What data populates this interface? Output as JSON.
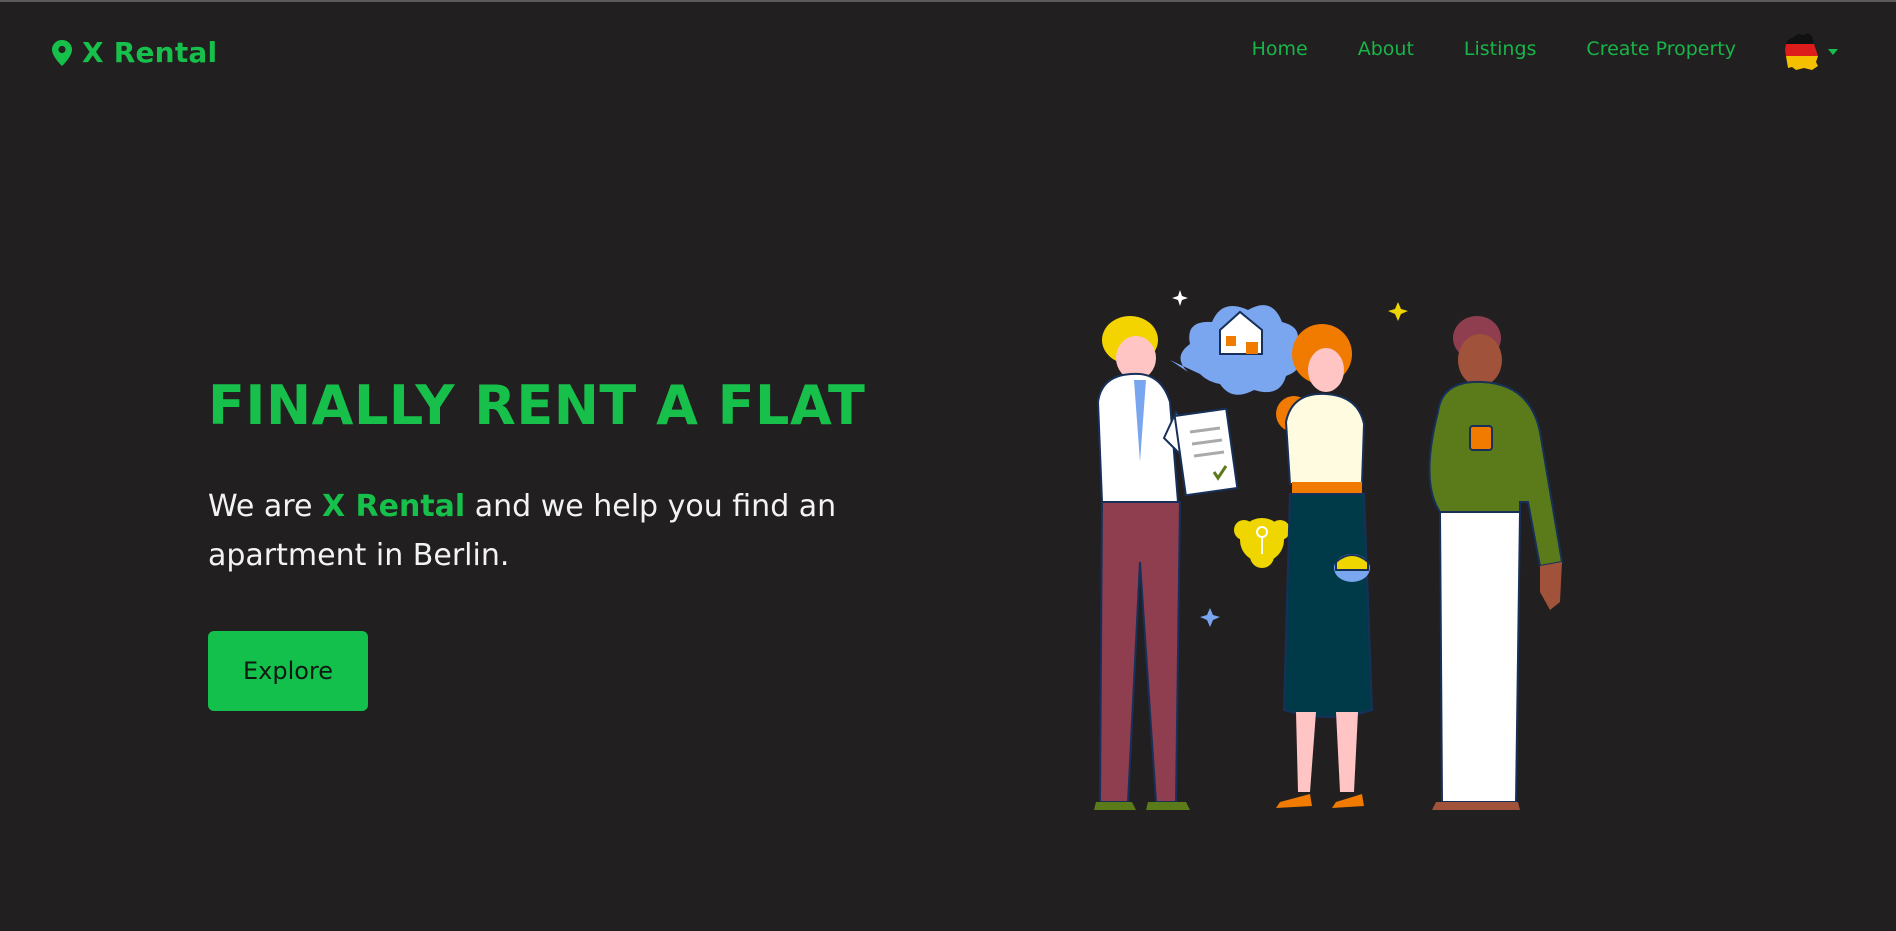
{
  "brand": {
    "name": "X Rental",
    "icon": "map-pin-icon",
    "color": "#17c04b"
  },
  "nav": {
    "items": [
      {
        "label": "Home"
      },
      {
        "label": "About"
      },
      {
        "label": "Listings"
      },
      {
        "label": "Create Property"
      }
    ],
    "language": {
      "icon": "germany-flag-icon",
      "dropdown_icon": "caret-down-icon"
    }
  },
  "hero": {
    "title": "FINALLY RENT A FLAT",
    "subtitle_prefix": "We are ",
    "subtitle_highlight": "X Rental",
    "subtitle_suffix": " and we help you find an apartment in Berlin.",
    "cta_label": "Explore",
    "illustration": "people-renting-illustration"
  },
  "colors": {
    "accent": "#17c04b",
    "background": "#211f20",
    "nav_link": "#18b548"
  }
}
